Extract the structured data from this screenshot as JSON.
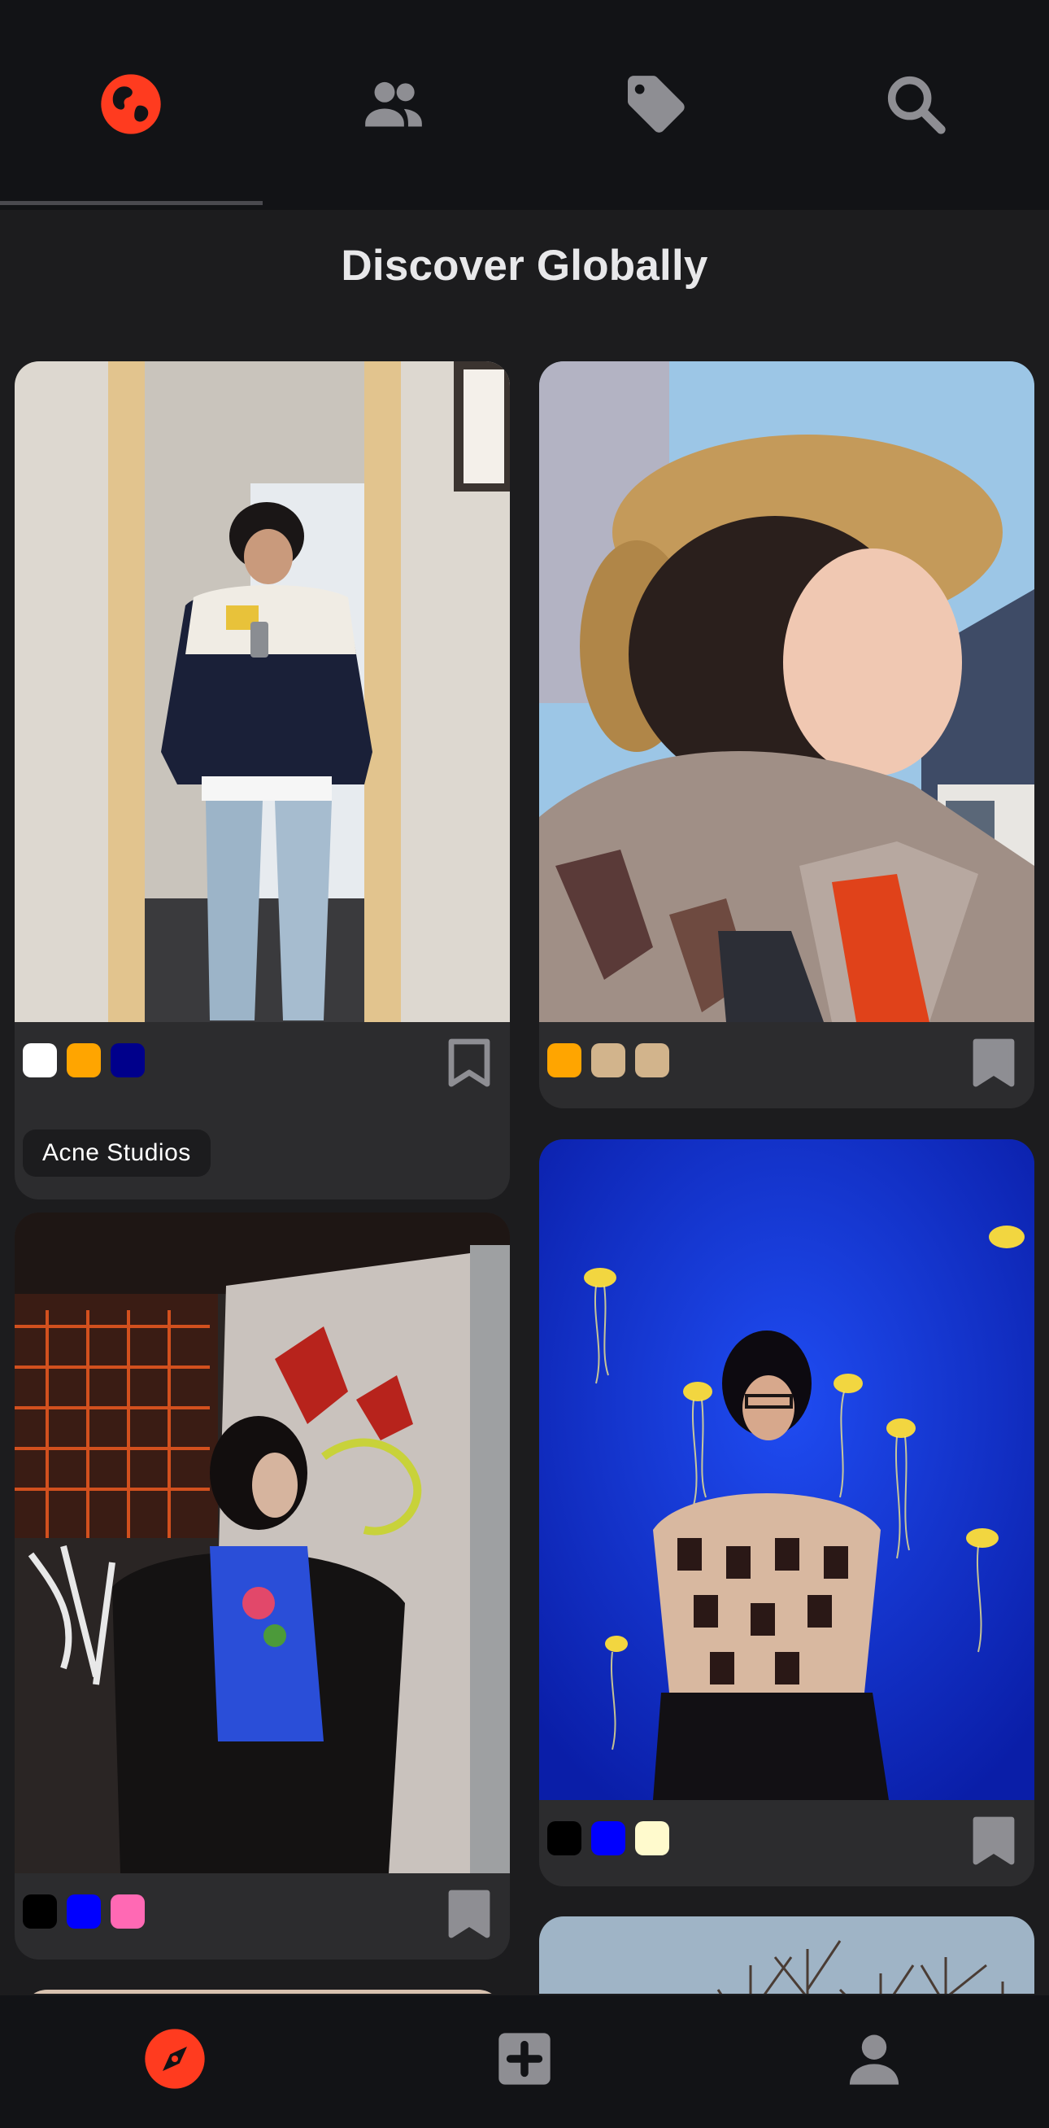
{
  "header": {
    "tabs": [
      {
        "name": "discover",
        "icon": "globe-icon",
        "active": true,
        "color": "#ff3b1f"
      },
      {
        "name": "following",
        "icon": "people-icon",
        "active": false,
        "color": "#8e8e93"
      },
      {
        "name": "tags",
        "icon": "tag-icon",
        "active": false,
        "color": "#8e8e93"
      },
      {
        "name": "search",
        "icon": "search-icon",
        "active": false,
        "color": "#8e8e93"
      }
    ]
  },
  "page": {
    "title": "Discover Globally"
  },
  "posts": [
    {
      "photo": "mirror selfie in varsity jacket",
      "swatches": [
        "#ffffff",
        "#ffa500",
        "#00008b"
      ],
      "tag": "Acne Studios",
      "bookmark_icon": "bookmark-icon"
    },
    {
      "photo": "portrait with fur trapper hat and plaid scarf",
      "swatches": [
        "#ffa500",
        "#d2b48c",
        "#d2b48c"
      ],
      "bookmark_icon": "bookmark-icon"
    },
    {
      "photo": "person in fur coat by graffiti wall",
      "swatches": [
        "#000000",
        "#0000ff",
        "#ff69b4"
      ],
      "bookmark_icon": "bookmark-icon"
    },
    {
      "photo": "person in front of jellyfish aquarium",
      "swatches": [
        "#000000",
        "#0000ff",
        "#fffacd"
      ],
      "bookmark_icon": "bookmark-icon"
    }
  ],
  "bottom_nav": [
    {
      "name": "explore",
      "icon": "compass-icon",
      "active": true,
      "color": "#ff3b1f"
    },
    {
      "name": "create",
      "icon": "plus-square-icon",
      "active": false,
      "color": "#8e8e93"
    },
    {
      "name": "profile",
      "icon": "person-icon",
      "active": false,
      "color": "#8e8e93"
    }
  ]
}
